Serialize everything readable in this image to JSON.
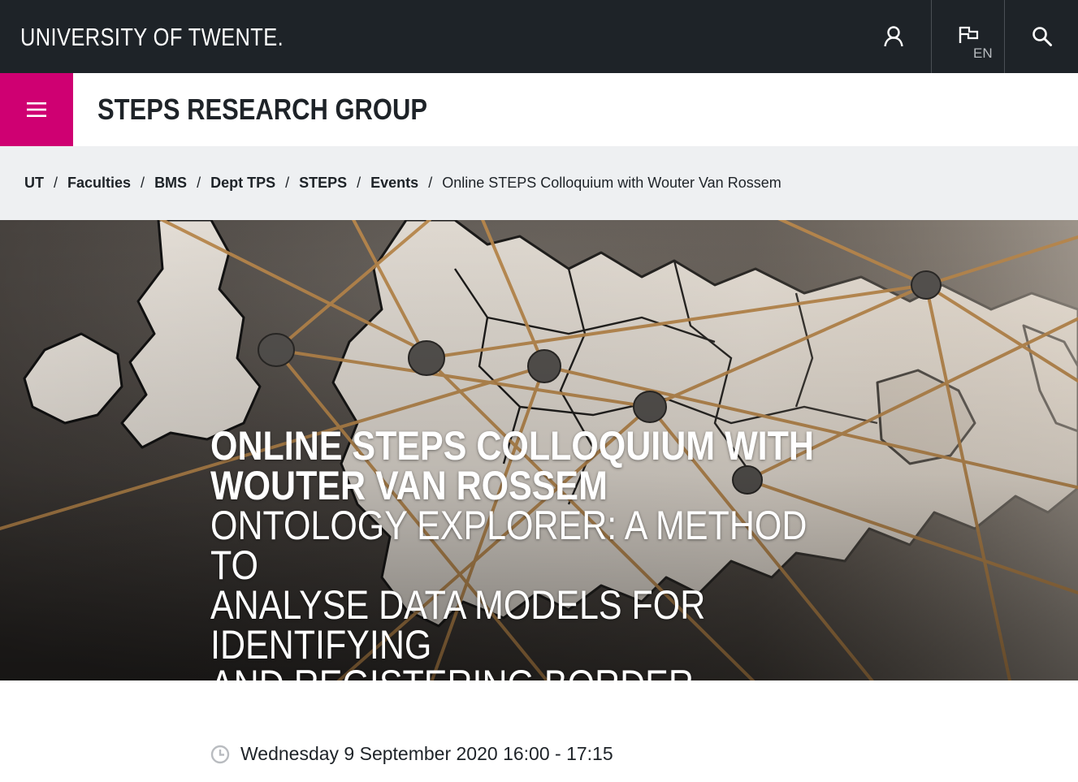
{
  "header": {
    "logo_text": "UNIVERSITY OF TWENTE.",
    "user_icon": "user-icon",
    "language_icon": "flag-icon",
    "language_code": "EN",
    "search_icon": "search-icon"
  },
  "group": {
    "menu_icon": "hamburger-menu-icon",
    "title": "STEPS RESEARCH GROUP"
  },
  "breadcrumb": {
    "items": [
      "UT",
      "Faculties",
      "BMS",
      "Dept TPS",
      "STEPS",
      "Events"
    ],
    "separator": "/",
    "current": "Online STEPS Colloquium with Wouter Van Rossem"
  },
  "hero": {
    "title_line1": "ONLINE STEPS COLLOQUIUM WITH",
    "title_line2": "WOUTER VAN ROSSEM",
    "subtitle_line1": "ONTOLOGY EXPLORER: A METHOD TO",
    "subtitle_line2": "ANALYSE DATA MODELS FOR IDENTIFYING",
    "subtitle_line3": "AND REGISTERING BORDER CROSSERS"
  },
  "event": {
    "clock_icon": "clock-icon",
    "datetime": "Wednesday 9 September 2020 16:00 - 17:15"
  },
  "colors": {
    "topbar": "#1e2328",
    "accent": "#cf0072",
    "breadcrumb_bg": "#eef0f2"
  }
}
